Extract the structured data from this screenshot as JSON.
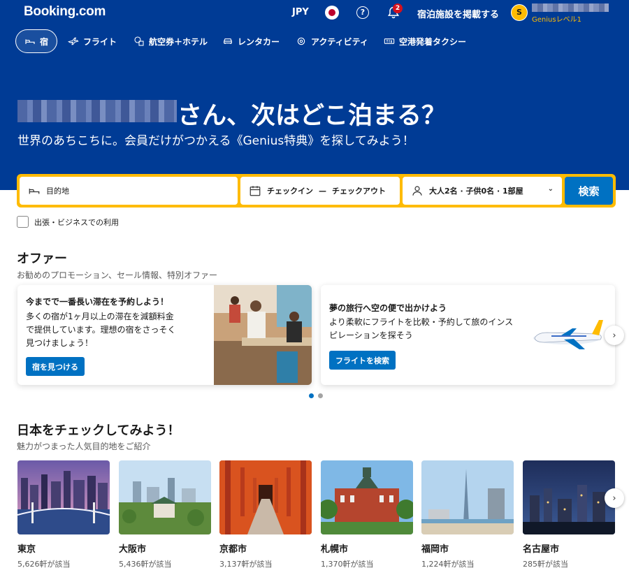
{
  "header": {
    "logo": "Booking.com",
    "currency": "JPY",
    "help_symbol": "?",
    "notification_count": "2",
    "list_property": "宿泊施設を掲載する",
    "avatar_initial": "S",
    "genius_level": "Geniusレベル1"
  },
  "nav": {
    "stays": "宿",
    "flights": "フライト",
    "flight_hotel": "航空券＋ホテル",
    "car_rental": "レンタカー",
    "activities": "アクティビティ",
    "taxi": "空港発着タクシー"
  },
  "hero": {
    "title": "さん、次はどこ泊まる？",
    "subtitle": "世界のあちこちに。会員だけがつかえる《Genius特典》を探してみよう！"
  },
  "search": {
    "destination_placeholder": "目的地",
    "checkin": "チェックイン",
    "dash": "—",
    "checkout": "チェックアウト",
    "guests": "大人2名 · 子供0名 · 1部屋",
    "button": "検索"
  },
  "business_travel": "出張・ビジネスでの利用",
  "offers": {
    "title": "オファー",
    "subtitle": "お勧めのプロモーション、セール情報、特別オファー",
    "items": [
      {
        "heading": "今までで一番長い滞在を予約しよう！",
        "text": "多くの宿が1ヶ月以上の滞在を減額料金\nで提供しています。理想の宿をさっそく\n見つけましょう！",
        "line1": "多くの宿が1ヶ月以上の滞在を減額料金",
        "line2": "で提供しています。理想の宿をさっそく",
        "line3": "見つけましょう！",
        "button": "宿を見つける"
      },
      {
        "heading": "夢の旅行へ空の便で出かけよう",
        "line1": "より柔軟にフライトを比較・予約して旅のインス",
        "line2": "ピレーションを探そう",
        "button": "フライトを検索"
      }
    ]
  },
  "japan": {
    "title": "日本をチェックしてみよう！",
    "subtitle": "魅力がつまった人気目的地をご紹介",
    "destinations": [
      {
        "name": "東京",
        "count": "5,626軒が該当"
      },
      {
        "name": "大阪市",
        "count": "5,436軒が該当"
      },
      {
        "name": "京都市",
        "count": "3,137軒が該当"
      },
      {
        "name": "札幌市",
        "count": "1,370軒が該当"
      },
      {
        "name": "福岡市",
        "count": "1,224軒が該当"
      },
      {
        "name": "名古屋市",
        "count": "285軒が該当"
      }
    ]
  },
  "colors": {
    "brand_blue": "#003b95",
    "accent_yellow": "#febb02",
    "button_blue": "#0071c2"
  }
}
